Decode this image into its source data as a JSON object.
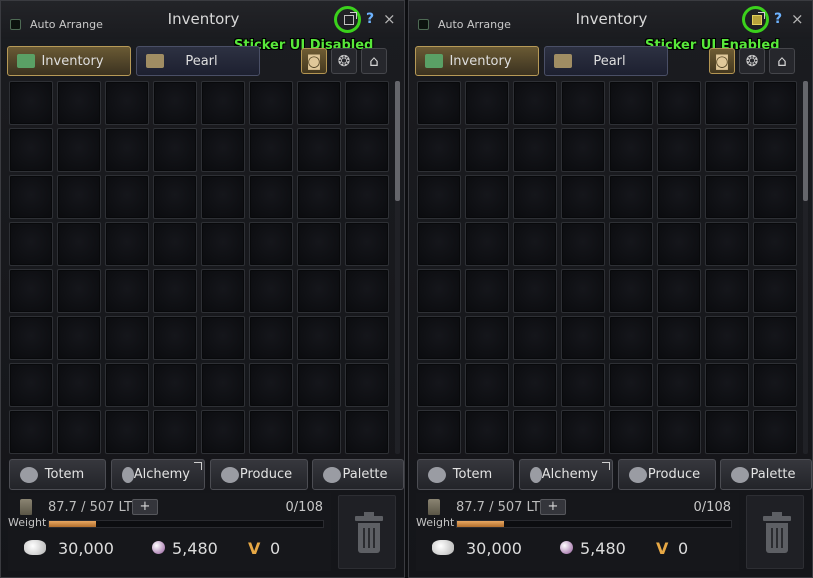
{
  "panels": [
    {
      "header": {
        "auto_arrange_label": "Auto Arrange",
        "title": "Inventory",
        "help": "?",
        "close": "×"
      },
      "annotation": "Sticker UI Disabled",
      "sticker_ui_enabled": false,
      "tabs": [
        {
          "label": "Inventory",
          "active": true
        },
        {
          "label": "Pearl",
          "active": false
        }
      ],
      "side_buttons": [
        {
          "icon": "bag-icon",
          "active": true
        },
        {
          "icon": "wagon-wheel-icon",
          "active": false
        },
        {
          "icon": "home-icon",
          "active": false
        }
      ],
      "grid": {
        "columns": 8,
        "visible_rows": 8
      },
      "actions": [
        {
          "label": "Totem",
          "icon": "totem-icon"
        },
        {
          "label": "Alchemy",
          "icon": "alchemy-icon"
        },
        {
          "label": "Produce",
          "icon": "produce-icon"
        },
        {
          "label": "Palette",
          "icon": "palette-icon"
        }
      ],
      "footer": {
        "weight_current": "87.7",
        "weight_sep": " / ",
        "weight_max": "507 LT",
        "plus": "+",
        "slots": "0/108",
        "weight_label": "Weight",
        "weight_fraction": 0.173,
        "silver": "30,000",
        "pearls": "5,480",
        "vp_symbol": "V",
        "vp": "0"
      }
    },
    {
      "header": {
        "auto_arrange_label": "Auto Arrange",
        "title": "Inventory",
        "help": "?",
        "close": "×"
      },
      "annotation": "Sticker UI Enabled",
      "sticker_ui_enabled": true,
      "tabs": [
        {
          "label": "Inventory",
          "active": true
        },
        {
          "label": "Pearl",
          "active": false
        }
      ],
      "side_buttons": [
        {
          "icon": "bag-icon",
          "active": true
        },
        {
          "icon": "wagon-wheel-icon",
          "active": false
        },
        {
          "icon": "home-icon",
          "active": false
        }
      ],
      "grid": {
        "columns": 8,
        "visible_rows": 8
      },
      "actions": [
        {
          "label": "Totem",
          "icon": "totem-icon"
        },
        {
          "label": "Alchemy",
          "icon": "alchemy-icon"
        },
        {
          "label": "Produce",
          "icon": "produce-icon"
        },
        {
          "label": "Palette",
          "icon": "palette-icon"
        }
      ],
      "footer": {
        "weight_current": "87.7",
        "weight_sep": " / ",
        "weight_max": "507 LT",
        "plus": "+",
        "slots": "0/108",
        "weight_label": "Weight",
        "weight_fraction": 0.173,
        "silver": "30,000",
        "pearls": "5,480",
        "vp_symbol": "V",
        "vp": "0"
      }
    }
  ],
  "colors": {
    "annotation_green": "#58e83a",
    "highlight_ring": "#3bd11c",
    "weight_bar": "#e8a863",
    "active_tab_border": "#b79a57"
  }
}
